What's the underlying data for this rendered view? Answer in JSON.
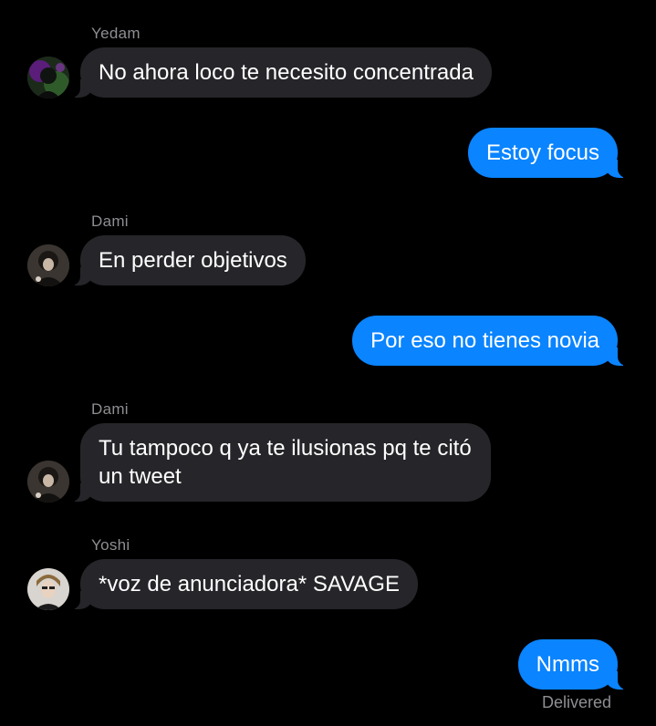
{
  "messages": [
    {
      "sender": "Yedam",
      "text": "No ahora loco te necesito concentrada",
      "direction": "incoming",
      "avatar": "avatar-yedam"
    },
    {
      "text": "Estoy focus",
      "direction": "outgoing"
    },
    {
      "sender": "Dami",
      "text": "En perder objetivos",
      "direction": "incoming",
      "avatar": "avatar-dami"
    },
    {
      "text": "Por eso no tienes novia",
      "direction": "outgoing"
    },
    {
      "sender": "Dami",
      "text": "Tu tampoco q ya te ilusionas pq te citó un tweet",
      "direction": "incoming",
      "avatar": "avatar-dami"
    },
    {
      "sender": "Yoshi",
      "text": "*voz de anunciadora* SAVAGE",
      "direction": "incoming",
      "avatar": "avatar-yoshi"
    },
    {
      "text": "Nmms",
      "direction": "outgoing"
    }
  ],
  "delivery_status": "Delivered",
  "colors": {
    "background": "#000000",
    "incoming_bubble": "#262529",
    "outgoing_bubble": "#0a84ff",
    "sender_name": "#8e8e93"
  }
}
